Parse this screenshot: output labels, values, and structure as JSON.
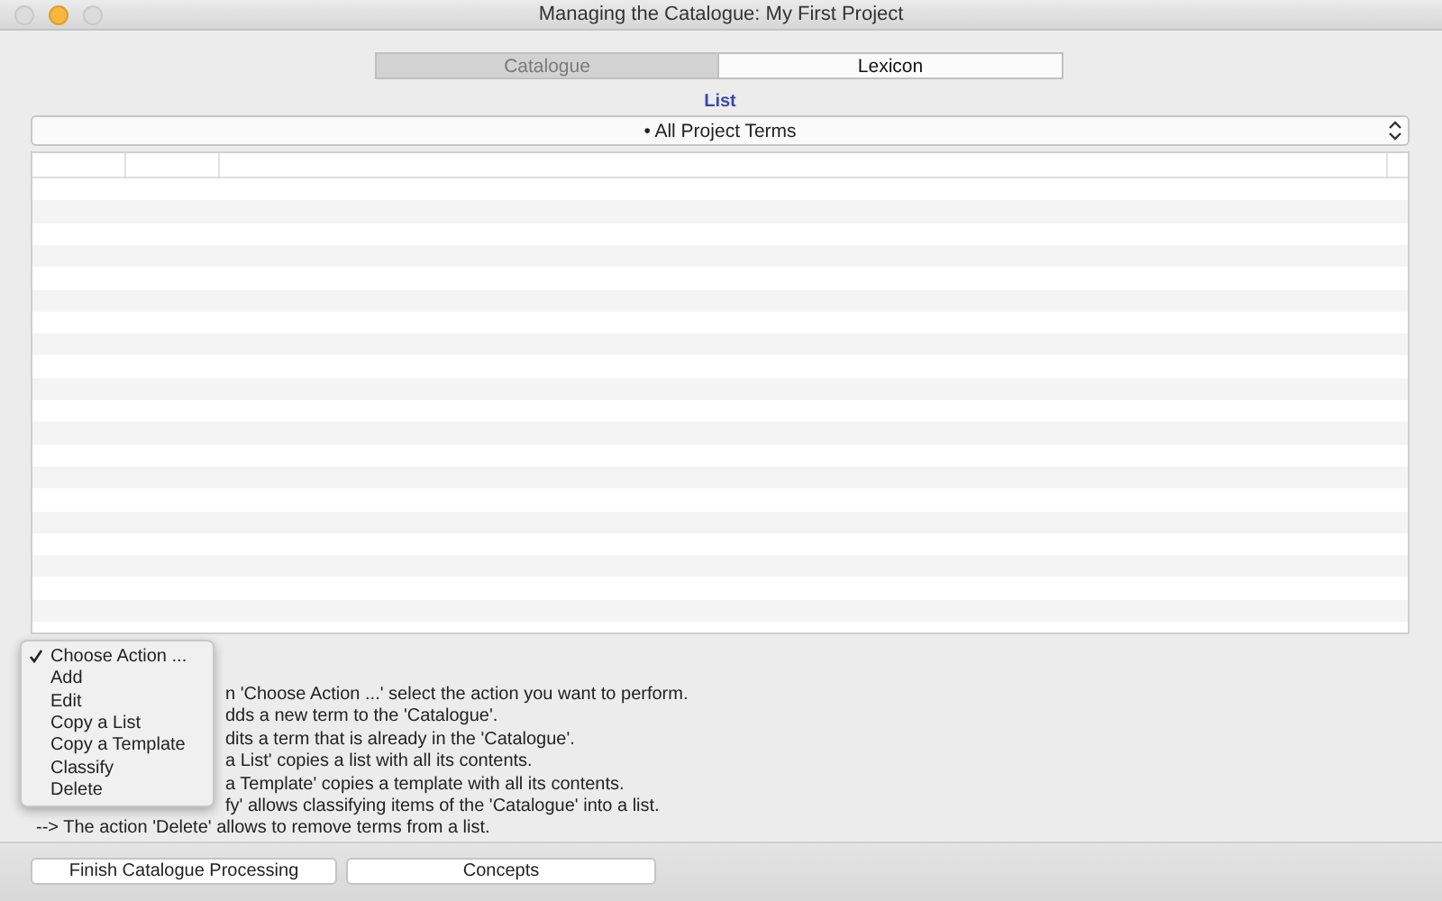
{
  "window": {
    "title": "Managing the Catalogue: My First Project"
  },
  "tabs": [
    {
      "label": "Catalogue",
      "selected": true
    },
    {
      "label": "Lexicon",
      "selected": false
    }
  ],
  "list_label": "List",
  "list_popup": {
    "value": "• All Project Terms"
  },
  "help_lines_behind_menu": [
    "n  'Choose Action ...'  select the action you want to perform.",
    "dds a new term to the 'Catalogue'.",
    "dits a term that is already in the 'Catalogue'.",
    "a List' copies a list with all its contents.",
    "a Template' copies a template with all its contents.",
    "fy' allows classifying items of the 'Catalogue' into a list."
  ],
  "help_last_line": "--> The action 'Delete' allows to remove terms from a list.",
  "action_menu": [
    {
      "label": "Choose Action ...",
      "checked": true
    },
    {
      "label": "Add",
      "checked": false
    },
    {
      "label": "Edit",
      "checked": false
    },
    {
      "label": "Copy a List",
      "checked": false
    },
    {
      "label": "Copy a Template",
      "checked": false
    },
    {
      "label": "Classify",
      "checked": false
    },
    {
      "label": "Delete",
      "checked": false
    }
  ],
  "buttons": [
    "Finish Catalogue Processing",
    "Concepts"
  ]
}
